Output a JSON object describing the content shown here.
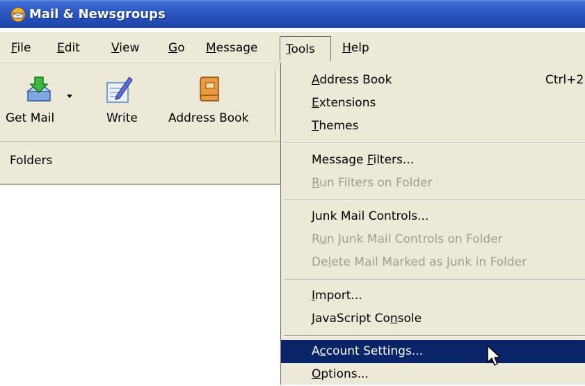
{
  "window": {
    "title": "Mail & Newsgroups",
    "icon": "mail-globe-icon"
  },
  "menubar": {
    "file": "File",
    "edit": "Edit",
    "view": "View",
    "go": "Go",
    "message": "Message",
    "tools": "Tools",
    "help": "Help"
  },
  "toolbar": {
    "get_mail": "Get Mail",
    "write": "Write",
    "address_book": "Address Book"
  },
  "folders_pane": {
    "header": "Folders"
  },
  "tools_menu": {
    "address_book": "Address Book",
    "address_book_shortcut": "Ctrl+2",
    "extensions": "Extensions",
    "themes": "Themes",
    "message_filters": "Message Filters...",
    "run_filters": "Run Filters on Folder",
    "junk_controls": "Junk Mail Controls...",
    "run_junk": "Run Junk Mail Controls on Folder",
    "delete_junk": "Delete Mail Marked as Junk in Folder",
    "import": "Import...",
    "js_console": "JavaScript Console",
    "account_settings": "Account Settings...",
    "options": "Options..."
  },
  "colors": {
    "highlight": "#0a246a",
    "menu_bg": "#ece9d8",
    "titlebar": "#2a56c0"
  }
}
